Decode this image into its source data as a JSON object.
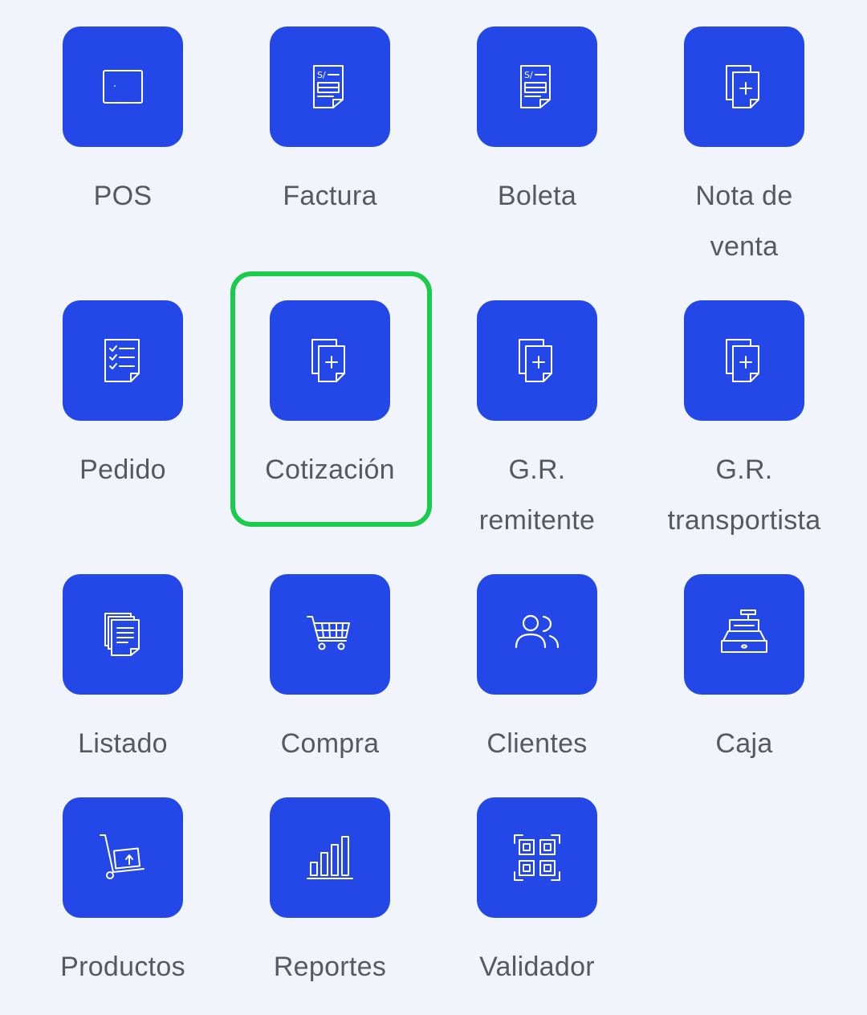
{
  "menu": {
    "items": [
      {
        "id": "pos",
        "label": "POS",
        "icon": "tablet-icon"
      },
      {
        "id": "factura",
        "label": "Factura",
        "icon": "invoice-icon"
      },
      {
        "id": "boleta",
        "label": "Boleta",
        "icon": "receipt-icon"
      },
      {
        "id": "nota-venta",
        "label": "Nota de venta",
        "icon": "add-document-icon"
      },
      {
        "id": "pedido",
        "label": "Pedido",
        "icon": "checklist-icon"
      },
      {
        "id": "cotizacion",
        "label": "Cotización",
        "icon": "add-document-icon"
      },
      {
        "id": "gr-remitente",
        "label": "G.R. remitente",
        "icon": "add-document-icon"
      },
      {
        "id": "gr-transportista",
        "label": "G.R. transportista",
        "icon": "add-document-icon"
      },
      {
        "id": "listado",
        "label": "Listado",
        "icon": "documents-icon"
      },
      {
        "id": "compra",
        "label": "Compra",
        "icon": "cart-icon"
      },
      {
        "id": "clientes",
        "label": "Clientes",
        "icon": "users-icon"
      },
      {
        "id": "caja",
        "label": "Caja",
        "icon": "cash-register-icon"
      },
      {
        "id": "productos",
        "label": "Productos",
        "icon": "hand-truck-icon"
      },
      {
        "id": "reportes",
        "label": "Reportes",
        "icon": "bar-chart-icon"
      },
      {
        "id": "validador",
        "label": "Validador",
        "icon": "qr-code-icon"
      }
    ],
    "selected": "Cotización"
  },
  "colors": {
    "tile_background": "#2448e8",
    "page_background": "#f1f4fb",
    "label_text": "#56595f",
    "highlight_border": "#1bcb4c",
    "icon_stroke": "#ffffff"
  }
}
